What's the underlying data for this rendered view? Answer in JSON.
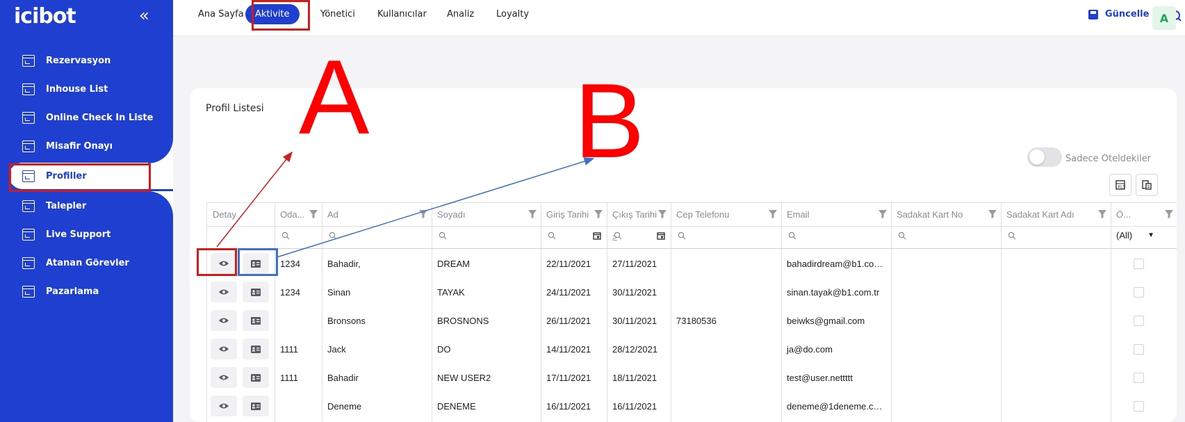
{
  "app": {
    "logo": "icibot",
    "collapse_glyph": "«"
  },
  "sidebar": {
    "items": [
      {
        "label": "Rezervasyon"
      },
      {
        "label": "Inhouse List"
      },
      {
        "label": "Online Check In Liste"
      },
      {
        "label": "Misafir Onayı"
      },
      {
        "label": "Profiller",
        "active": true
      },
      {
        "label": "Talepler"
      },
      {
        "label": "Live Support"
      },
      {
        "label": "Atanan Görevler"
      },
      {
        "label": "Pazarlama"
      }
    ]
  },
  "topbar": {
    "menu": [
      {
        "label": "Ana Sayfa"
      },
      {
        "label": "Aktivite",
        "active": true
      },
      {
        "label": "Yönetici"
      },
      {
        "label": "Kullanıcılar"
      },
      {
        "label": "Analiz"
      },
      {
        "label": "Loyalty"
      }
    ],
    "update_label": "Güncelle",
    "icons": [
      "search-icon",
      "chart-icon",
      "bell-icon",
      "apps-icon",
      "flag-tr-icon"
    ],
    "avatar_initial": "A"
  },
  "card": {
    "title": "Profil Listesi",
    "toggle_label": "Sadece Oteldekiler",
    "tools": [
      "excel-export-icon",
      "column-chooser-icon"
    ]
  },
  "grid": {
    "columns": [
      "Detay",
      "Oda...",
      "Ad",
      "Soyadı",
      "Giriş Tarihi",
      "Çıkış Tarihi",
      "Cep Telefonu",
      "Email",
      "Sadakat Kart No",
      "Sadakat Kart Adı",
      "Ö..."
    ],
    "filter": {
      "last_col_value": "(All)",
      "checkout_operator": "≥"
    },
    "rows": [
      {
        "room": "1234",
        "ad": "Bahadir,",
        "soyadi": "DREAM",
        "giris": "22/11/2021",
        "cikis": "27/11/2021",
        "tel": "",
        "email": "bahadirdream@b1.co…"
      },
      {
        "room": "1234",
        "ad": "Sinan",
        "soyadi": "TAYAK",
        "giris": "24/11/2021",
        "cikis": "30/11/2021",
        "tel": "",
        "email": "sinan.tayak@b1.com.tr"
      },
      {
        "room": "",
        "ad": "Bronsons",
        "soyadi": "BROSNONS",
        "giris": "26/11/2021",
        "cikis": "30/11/2021",
        "tel": "73180536",
        "email": "beiwks@gmail.com"
      },
      {
        "room": "1111",
        "ad": "Jack",
        "soyadi": "DO",
        "giris": "14/11/2021",
        "cikis": "28/12/2021",
        "tel": "",
        "email": "ja@do.com"
      },
      {
        "room": "1111",
        "ad": "Bahadir",
        "soyadi": "NEW USER2",
        "giris": "17/11/2021",
        "cikis": "18/11/2021",
        "tel": "",
        "email": "test@user.nettttt"
      },
      {
        "room": "",
        "ad": "Deneme",
        "soyadi": "DENEME",
        "giris": "16/11/2021",
        "cikis": "16/11/2021",
        "tel": "",
        "email": "deneme@1deneme.c…"
      }
    ]
  },
  "annotations": {
    "a": "A",
    "b": "B"
  },
  "colors": {
    "brand": "#1f3fd1",
    "annotation_red": "#d21c1c",
    "annotation_blue": "#3f6fc6"
  }
}
